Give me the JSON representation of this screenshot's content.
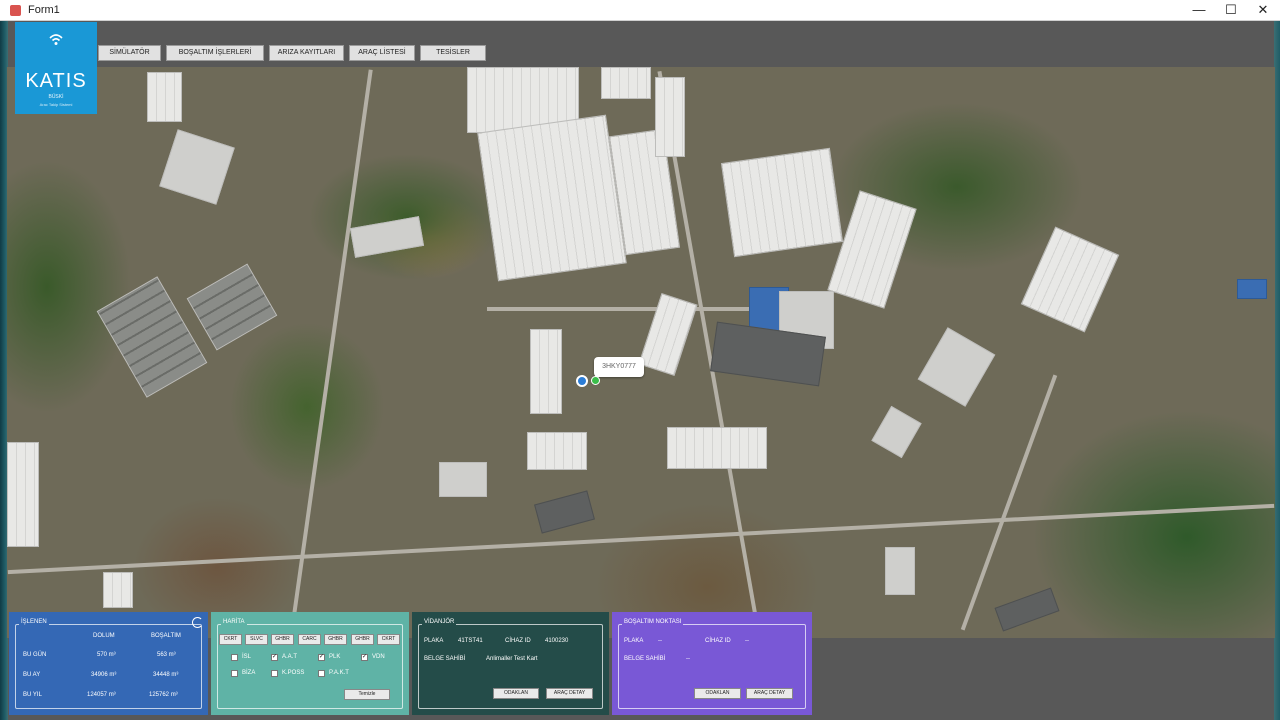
{
  "window": {
    "title": "Form1",
    "minimize_glyph": "—",
    "maximize_glyph": "☐",
    "close_glyph": "✕"
  },
  "logo": {
    "brand": "KATIS",
    "sub": "BÜSKİ",
    "sub2": "Arac Takip Sistemi"
  },
  "menu": [
    {
      "label": "SİMÜLATÖR"
    },
    {
      "label": "BOŞALTIM İŞLERLERİ"
    },
    {
      "label": "ARIZA KAYITLARI"
    },
    {
      "label": "ARAÇ LİSTESİ"
    },
    {
      "label": "TESİSLER"
    }
  ],
  "map": {
    "bubble_label": "3HKY0777"
  },
  "stats_panel": {
    "legend": "İŞLENEN",
    "col_dolum": "DOLUM",
    "col_bosaltim": "BOŞALTIM",
    "rows": [
      {
        "label": "BU GÜN",
        "dolum": "570 m³",
        "bosaltim": "563 m³"
      },
      {
        "label": "BU AY",
        "dolum": "34906 m³",
        "bosaltim": "34448 m³"
      },
      {
        "label": "BU YIL",
        "dolum": "124057 m³",
        "bosaltim": "125762 m³"
      }
    ]
  },
  "filter_panel": {
    "legend": "HARİTA",
    "tags": [
      "CKRT",
      "SLVC",
      "GHBR",
      "CARC",
      "GHBR",
      "GHBR",
      "CKRT"
    ],
    "checks": [
      {
        "label": "İSL",
        "checked": false
      },
      {
        "label": "A.A.T",
        "checked": true
      },
      {
        "label": "PLK",
        "checked": true
      },
      {
        "label": "VDN",
        "checked": true
      },
      {
        "label": "BİZA",
        "checked": false
      },
      {
        "label": "K.POSS",
        "checked": false
      },
      {
        "label": "P.A.K.T",
        "checked": false
      }
    ],
    "clear_label": "Temizle"
  },
  "vehicle_panel": {
    "legend": "VİDANJÖR",
    "plaka_label": "PLAKA",
    "plaka_value": "41TST41",
    "cihaz_label": "CİHAZ ID",
    "cihaz_value": "4100230",
    "belge_label": "BELGE SAHİBİ",
    "belge_value": "Anlimaller Test Kart",
    "focus_label": "ODAKLAN",
    "detail_label": "ARAÇ DETAY"
  },
  "discharge_panel": {
    "legend": "BOŞALTIM NOKTASI",
    "plaka_label": "PLAKA",
    "plaka_value": "--",
    "cihaz_label": "CİHAZ ID",
    "cihaz_value": "--",
    "belge_label": "BELGE SAHİBİ",
    "belge_value": "--",
    "focus_label": "ODAKLAN",
    "detail_label": "ARAÇ DETAY"
  }
}
